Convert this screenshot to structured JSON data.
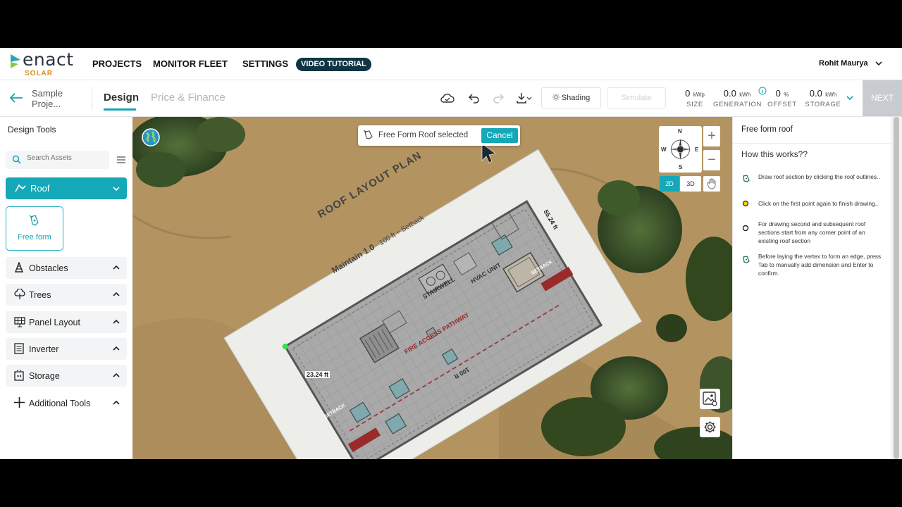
{
  "brand": {
    "name": "enact",
    "sub": "SOLAR",
    "colors": {
      "accent": "#14a8b8",
      "orange": "#e08a14",
      "dark": "#0f3444"
    }
  },
  "nav": {
    "projects": "PROJECTS",
    "monitor": "MONITOR FLEET",
    "settings": "SETTINGS",
    "video": "VIDEO TUTORIAL",
    "user": "Rohit Maurya"
  },
  "project": {
    "name": "Sample Proje...",
    "tab_design": "Design",
    "tab_price": "Price & Finance"
  },
  "toolbar": {
    "shading": "Shading",
    "simulate": "Simulate",
    "next": "NEXT",
    "stats": [
      {
        "value": "0",
        "unit": "kWp",
        "label": "SIZE"
      },
      {
        "value": "0.0",
        "unit": "kWh",
        "label": "GENERATION"
      },
      {
        "value": "0",
        "unit": "%",
        "label": "OFFSET"
      },
      {
        "value": "0.0",
        "unit": "kWh",
        "label": "STORAGE"
      }
    ]
  },
  "left": {
    "title": "Design Tools",
    "search_placeholder": "Search Assets",
    "roof": "Roof",
    "freeform": "Free form",
    "sections": [
      {
        "label": "Obstacles",
        "icon": "obstacle-icon"
      },
      {
        "label": "Trees",
        "icon": "tree-icon"
      },
      {
        "label": "Panel Layout",
        "icon": "solar-panel-icon"
      },
      {
        "label": "Inverter",
        "icon": "inverter-icon"
      },
      {
        "label": "Storage",
        "icon": "battery-icon"
      },
      {
        "label": "Additional Tools",
        "icon": "plus-icon"
      }
    ]
  },
  "map": {
    "toast": "Free Form Roof selected",
    "cancel": "Cancel",
    "compass": {
      "n": "N",
      "s": "S",
      "e": "E",
      "w": "W"
    },
    "view_2d": "2D",
    "view_3d": "3D",
    "plan": {
      "title": "ROOF LAYOUT PLAN",
      "subtitle": "Maintain 1.0",
      "setback": "100 ft ÷ Setback",
      "stairwell": "STAIRWELL",
      "hvac": "HVAC UNIT",
      "pathway": "FIRE ACCESS PATHWAY",
      "setback_tag": "SETBACK",
      "dim_short": "23.24 ft",
      "dim_long": "55.24 ft",
      "dim_bottom": "100 ft"
    }
  },
  "right": {
    "title": "Free form roof",
    "how": "How this works??",
    "steps": [
      "Draw roof section by clicking the roof outlines..",
      "Click on the first point again to finish drawing..",
      "For drawing second and subsequent roof sections start from any corner point of an existing roof section",
      "Before laying the vertex to form an edge, press Tab to manually add dimension and Enter to confirm."
    ]
  }
}
